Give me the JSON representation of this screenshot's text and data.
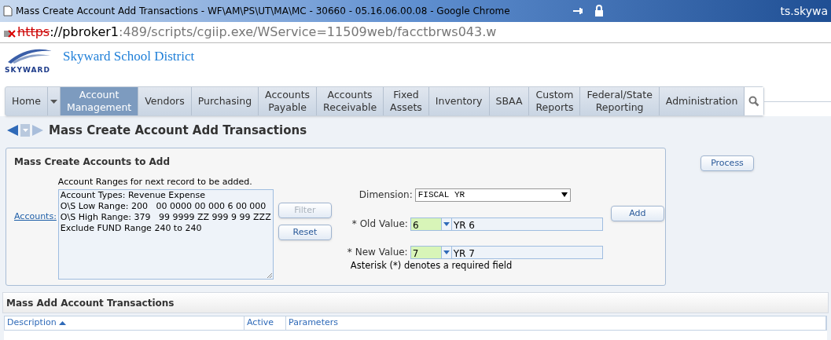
{
  "browser": {
    "title": "Mass Create Account Add Transactions - WF\\AM\\PS\\UT\\MA\\MC - 30660 - 05.16.06.00.08 - Google Chrome",
    "right_text": "ts.skywa",
    "url_scheme": "https",
    "url_host": "://pbroker1",
    "url_path": ":489/scripts/cgiip.exe/WService=11509web/facctbrws043.w"
  },
  "header": {
    "district": "Skyward School District",
    "logo_text": "SKYWARD"
  },
  "nav": [
    {
      "label": "Home",
      "kind": "home",
      "selected": false
    },
    {
      "label": "Account\nManagement",
      "kind": "tab",
      "selected": true
    },
    {
      "label": "Vendors",
      "kind": "tab",
      "selected": false
    },
    {
      "label": "Purchasing",
      "kind": "tab",
      "selected": false
    },
    {
      "label": "Accounts\nPayable",
      "kind": "tab",
      "selected": false
    },
    {
      "label": "Accounts\nReceivable",
      "kind": "tab",
      "selected": false
    },
    {
      "label": "Fixed\nAssets",
      "kind": "tab",
      "selected": false
    },
    {
      "label": "Inventory",
      "kind": "tab",
      "selected": false
    },
    {
      "label": "SBAA",
      "kind": "tab",
      "selected": false
    },
    {
      "label": "Custom\nReports",
      "kind": "tab",
      "selected": false
    },
    {
      "label": "Federal/State\nReporting",
      "kind": "tab",
      "selected": false
    },
    {
      "label": "Administration",
      "kind": "tab",
      "selected": false
    }
  ],
  "page_title": "Mass Create Account Add Transactions",
  "panel": {
    "title": "Mass Create Accounts to Add",
    "ranges_caption": "Account Ranges for next record to be added.",
    "accounts_link": "Accounts:",
    "ranges": [
      "Account Types: Revenue Expense",
      "O\\S Low Range: 200   00 0000 00 000 6 00 000",
      "O\\S High Range: 379   99 9999 ZZ 999 9 99 ZZZ",
      "Exclude FUND Range 240 to 240"
    ],
    "filter_button": {
      "label": "Filter",
      "disabled": true
    },
    "reset_button": {
      "label": "Reset",
      "disabled": false
    },
    "dimension_label": "Dimension:",
    "dimension_value": "FISCAL YR",
    "old_label": "* Old Value:",
    "old_value": "6",
    "old_desc": "YR 6",
    "new_label": "* New Value:",
    "new_value": "7",
    "new_desc": "YR 7",
    "note": "Asterisk (*) denotes a required field",
    "add_button": "Add"
  },
  "process_button": "Process",
  "grid": {
    "title": "Mass Add Account Transactions",
    "columns": [
      {
        "label": "Description",
        "sorted": true
      },
      {
        "label": "Active",
        "sorted": false
      },
      {
        "label": "Parameters",
        "sorted": false
      }
    ]
  }
}
